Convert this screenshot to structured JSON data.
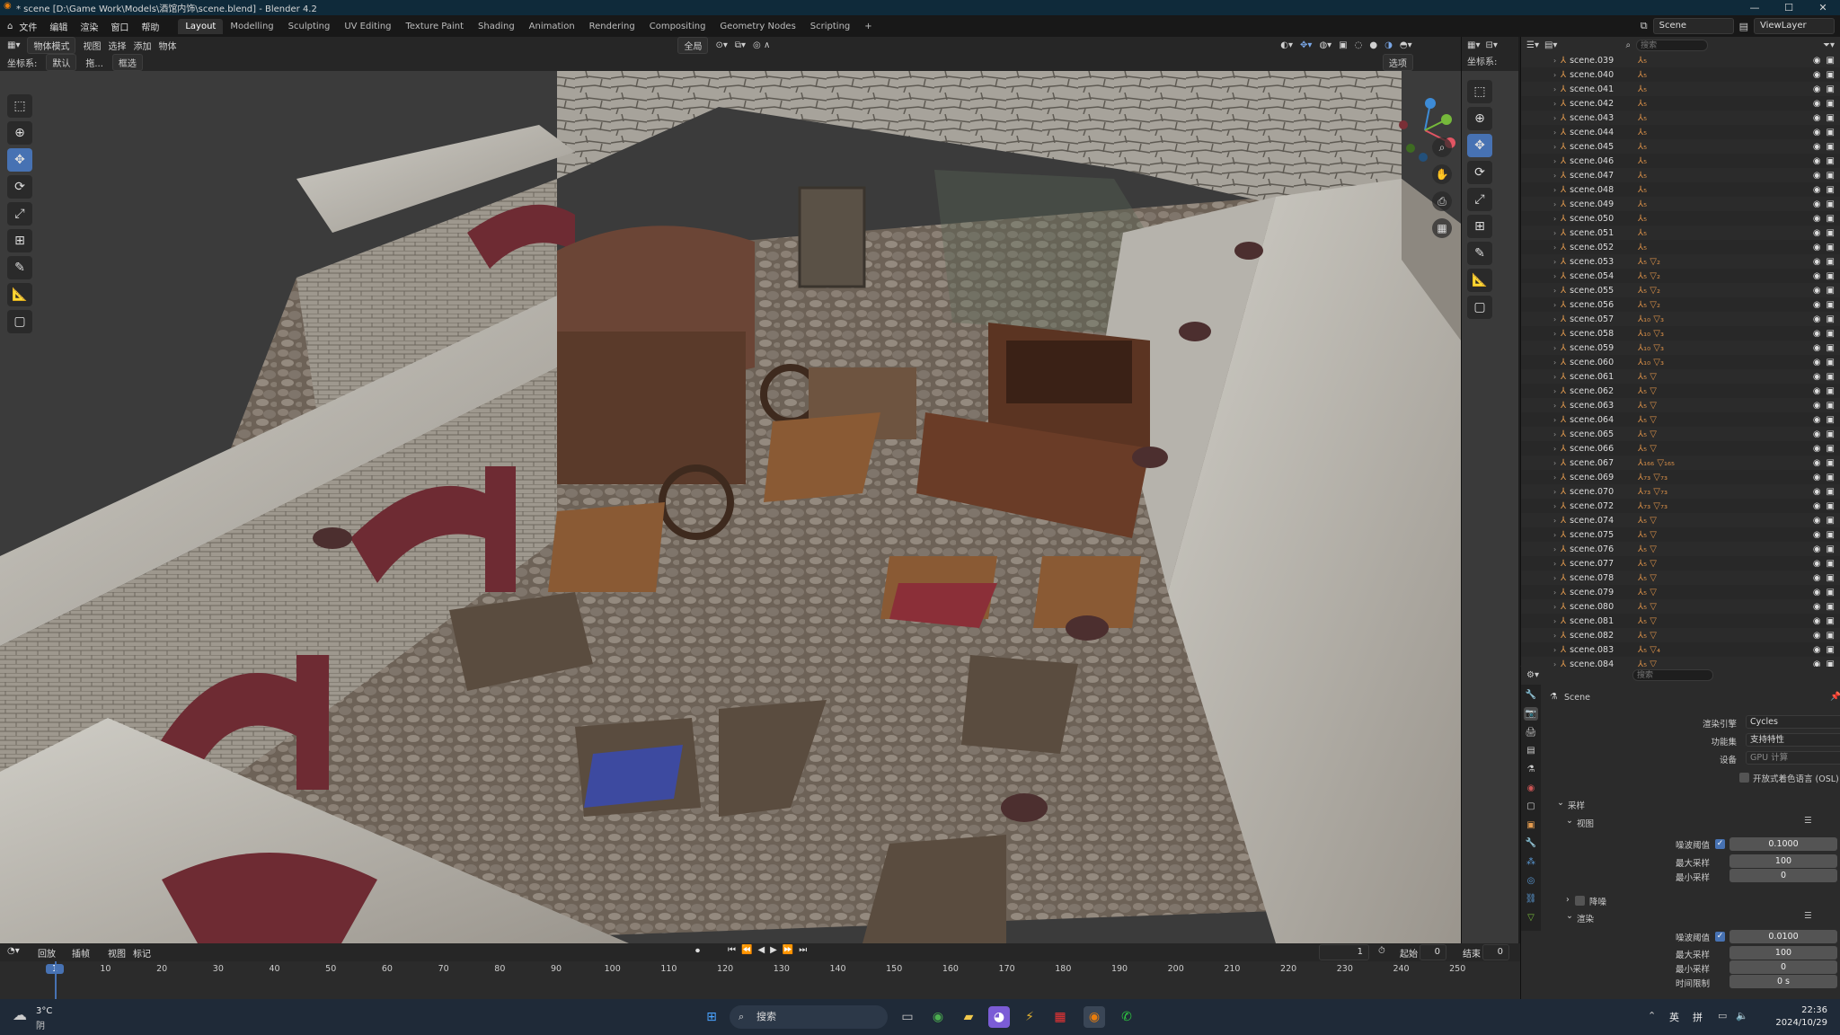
{
  "window": {
    "title": "* scene [D:\\Game Work\\Models\\酒馆内饰\\scene.blend] - Blender 4.2",
    "minimize": "—",
    "maximize": "☐",
    "close": "✕"
  },
  "menu": [
    "文件",
    "编辑",
    "渲染",
    "窗口",
    "帮助"
  ],
  "workspaces": [
    "Layout",
    "Modelling",
    "Sculpting",
    "UV Editing",
    "Texture Paint",
    "Shading",
    "Animation",
    "Rendering",
    "Compositing",
    "Geometry Nodes",
    "Scripting",
    "+"
  ],
  "active_workspace": "Layout",
  "topbar_right": {
    "scene": "Scene",
    "view_layer": "ViewLayer"
  },
  "viewport_header": {
    "mode": "物体模式",
    "items": [
      "视图",
      "选择",
      "添加",
      "物体"
    ],
    "transform": "全局",
    "options": "选项"
  },
  "viewport_header2": {
    "orientation_label": "坐标系:",
    "orientation": "默认",
    "drag_label": "拖...",
    "drag": "框选"
  },
  "outliner": {
    "search_placeholder": "搜索",
    "rows": [
      {
        "name": "scene.039",
        "mods": "⅄₅"
      },
      {
        "name": "scene.040",
        "mods": "⅄₅"
      },
      {
        "name": "scene.041",
        "mods": "⅄₅"
      },
      {
        "name": "scene.042",
        "mods": "⅄₅"
      },
      {
        "name": "scene.043",
        "mods": "⅄₅"
      },
      {
        "name": "scene.044",
        "mods": "⅄₅"
      },
      {
        "name": "scene.045",
        "mods": "⅄₅"
      },
      {
        "name": "scene.046",
        "mods": "⅄₅"
      },
      {
        "name": "scene.047",
        "mods": "⅄₅"
      },
      {
        "name": "scene.048",
        "mods": "⅄₅"
      },
      {
        "name": "scene.049",
        "mods": "⅄₅"
      },
      {
        "name": "scene.050",
        "mods": "⅄₅"
      },
      {
        "name": "scene.051",
        "mods": "⅄₅"
      },
      {
        "name": "scene.052",
        "mods": "⅄₅"
      },
      {
        "name": "scene.053",
        "mods": "⅄₅ ▽₂"
      },
      {
        "name": "scene.054",
        "mods": "⅄₅ ▽₂"
      },
      {
        "name": "scene.055",
        "mods": "⅄₅ ▽₂"
      },
      {
        "name": "scene.056",
        "mods": "⅄₅ ▽₂"
      },
      {
        "name": "scene.057",
        "mods": "⅄₁₀ ▽₃"
      },
      {
        "name": "scene.058",
        "mods": "⅄₁₀ ▽₃"
      },
      {
        "name": "scene.059",
        "mods": "⅄₁₀ ▽₃"
      },
      {
        "name": "scene.060",
        "mods": "⅄₁₀ ▽₃"
      },
      {
        "name": "scene.061",
        "mods": "⅄₅ ▽"
      },
      {
        "name": "scene.062",
        "mods": "⅄₅ ▽"
      },
      {
        "name": "scene.063",
        "mods": "⅄₅ ▽"
      },
      {
        "name": "scene.064",
        "mods": "⅄₅ ▽"
      },
      {
        "name": "scene.065",
        "mods": "⅄₅ ▽"
      },
      {
        "name": "scene.066",
        "mods": "⅄₅ ▽"
      },
      {
        "name": "scene.067",
        "mods": "⅄₁₆₆ ▽₁₆₅"
      },
      {
        "name": "scene.069",
        "mods": "⅄₇₃ ▽₇₃"
      },
      {
        "name": "scene.070",
        "mods": "⅄₇₃ ▽₇₃"
      },
      {
        "name": "scene.072",
        "mods": "⅄₇₃ ▽₇₃"
      },
      {
        "name": "scene.074",
        "mods": "⅄₅ ▽"
      },
      {
        "name": "scene.075",
        "mods": "⅄₅ ▽"
      },
      {
        "name": "scene.076",
        "mods": "⅄₅ ▽"
      },
      {
        "name": "scene.077",
        "mods": "⅄₅ ▽"
      },
      {
        "name": "scene.078",
        "mods": "⅄₅ ▽"
      },
      {
        "name": "scene.079",
        "mods": "⅄₅ ▽"
      },
      {
        "name": "scene.080",
        "mods": "⅄₅ ▽"
      },
      {
        "name": "scene.081",
        "mods": "⅄₅ ▽"
      },
      {
        "name": "scene.082",
        "mods": "⅄₅ ▽"
      },
      {
        "name": "scene.083",
        "mods": "⅄₅ ▽₄"
      },
      {
        "name": "scene.084",
        "mods": "⅄₅ ▽"
      }
    ]
  },
  "properties": {
    "search_placeholder": "搜索",
    "context": "Scene",
    "render_engine_label": "渲染引擎",
    "render_engine": "Cycles",
    "feature_set_label": "功能集",
    "feature_set": "支持特性",
    "device_label": "设备",
    "device": "GPU 计算",
    "osl_label": "开放式着色语言 (OSL)",
    "sampling": "采样",
    "viewport": "视图",
    "render": "渲染",
    "denoise": "降噪",
    "noise_threshold_label": "噪波阈值",
    "max_samples_label": "最大采样",
    "min_samples_label": "最小采样",
    "time_limit_label": "时间限制",
    "vp_noise_threshold": "0.1000",
    "vp_max_samples": "100",
    "vp_min_samples": "0",
    "r_noise_threshold": "0.0100",
    "r_max_samples": "100",
    "r_min_samples": "0",
    "r_time_limit": "0 s"
  },
  "timeline": {
    "menu": [
      "回放",
      "插帧",
      "视图",
      "标记"
    ],
    "current_frame": "1",
    "start_label": "起始",
    "start": "0",
    "end_label": "结束",
    "end": "0",
    "ticks": [
      "1",
      "10",
      "20",
      "30",
      "40",
      "50",
      "60",
      "70",
      "80",
      "90",
      "100",
      "110",
      "120",
      "130",
      "140",
      "150",
      "160",
      "170",
      "180",
      "190",
      "200",
      "210",
      "220",
      "230",
      "240",
      "250"
    ]
  },
  "taskbar": {
    "weather_temp": "3°C",
    "weather_desc": "阴",
    "search": "搜索",
    "ime1": "英",
    "ime2": "拼",
    "time": "22:36",
    "date": "2024/10/29"
  },
  "colors": {
    "accent": "#4772b3",
    "object_orange": "#e39b4f"
  }
}
